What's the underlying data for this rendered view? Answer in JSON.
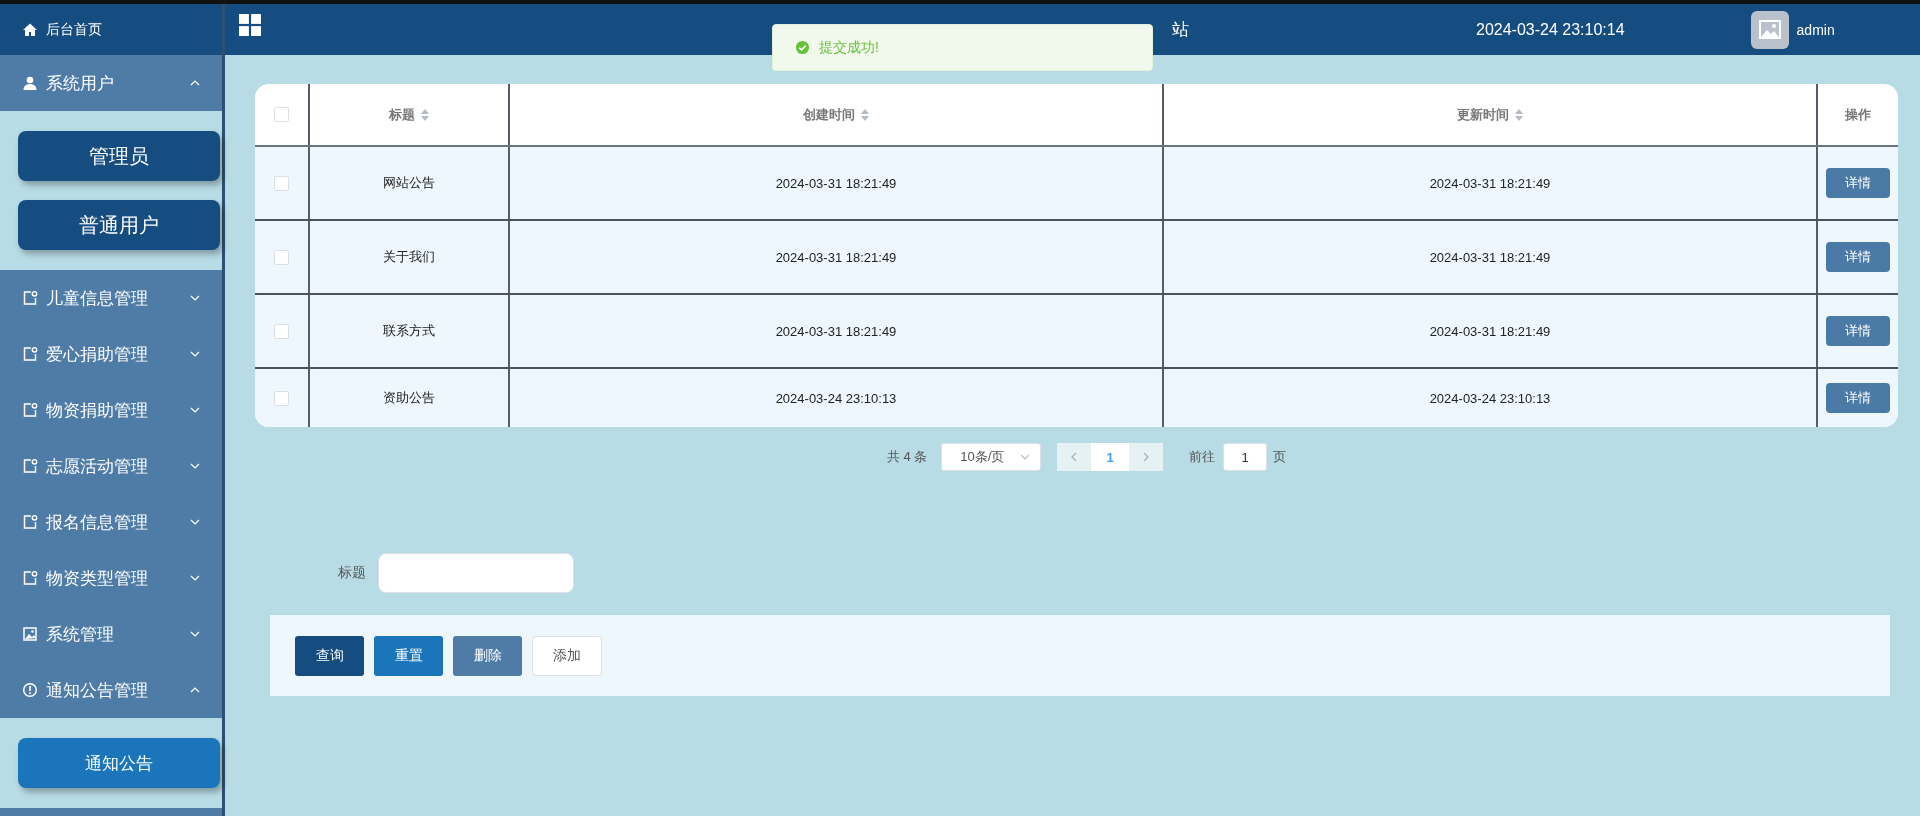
{
  "sidebar": {
    "home": {
      "label": "后台首页",
      "kind": "home"
    },
    "menus": [
      {
        "label": "系统用户",
        "kind": "user",
        "expanded": true,
        "children": [
          {
            "label": "管理员",
            "selected": false
          },
          {
            "label": "普通用户",
            "selected": false
          }
        ]
      },
      {
        "label": "儿童信息管理",
        "kind": "doc",
        "expanded": false
      },
      {
        "label": "爱心捐助管理",
        "kind": "doc",
        "expanded": false
      },
      {
        "label": "物资捐助管理",
        "kind": "doc",
        "expanded": false
      },
      {
        "label": "志愿活动管理",
        "kind": "doc",
        "expanded": false
      },
      {
        "label": "报名信息管理",
        "kind": "doc",
        "expanded": false
      },
      {
        "label": "物资类型管理",
        "kind": "doc",
        "expanded": false
      },
      {
        "label": "系统管理",
        "kind": "image",
        "expanded": false
      },
      {
        "label": "通知公告管理",
        "kind": "info",
        "expanded": true,
        "children": [
          {
            "label": "通知公告",
            "selected": true
          }
        ]
      }
    ]
  },
  "topbar": {
    "title_visible": "站",
    "datetime": "2024-03-24 23:10:14",
    "user": "admin"
  },
  "toast": {
    "message": "提交成功!"
  },
  "table": {
    "all_checked": false,
    "columns": [
      {
        "label": "标题",
        "sortable": true
      },
      {
        "label": "创建时间",
        "sortable": true
      },
      {
        "label": "更新时间",
        "sortable": true
      },
      {
        "label": "操作",
        "sortable": false
      }
    ],
    "rows": [
      {
        "checked": false,
        "cells": [
          "网站公告",
          "2024-03-31 18:21:49",
          "2024-03-31 18:21:49"
        ],
        "action": "详情"
      },
      {
        "checked": false,
        "cells": [
          "关于我们",
          "2024-03-31 18:21:49",
          "2024-03-31 18:21:49"
        ],
        "action": "详情"
      },
      {
        "checked": false,
        "cells": [
          "联系方式",
          "2024-03-31 18:21:49",
          "2024-03-31 18:21:49"
        ],
        "action": "详情"
      },
      {
        "checked": false,
        "cells": [
          "资助公告",
          "2024-03-24 23:10:13",
          "2024-03-24 23:10:13"
        ],
        "action": "详情"
      }
    ]
  },
  "pagination": {
    "total": "共 4 条",
    "page_size": "10条/页",
    "pages": [
      {
        "label": "1",
        "selected": true
      }
    ],
    "goto_label": "前往",
    "goto_value": "1",
    "page_unit": "页"
  },
  "search": {
    "label": "标题"
  },
  "buttons": [
    {
      "label": "查询",
      "kind": "primary"
    },
    {
      "label": "重置",
      "kind": "info"
    },
    {
      "label": "删除",
      "kind": "danger"
    },
    {
      "label": "添加",
      "kind": "plain"
    }
  ]
}
